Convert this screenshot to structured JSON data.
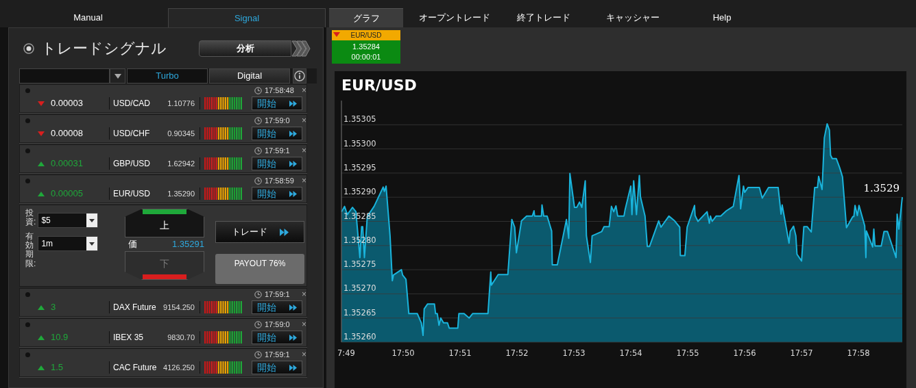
{
  "top_tabs_left": [
    {
      "label": "Manual",
      "selected": false
    },
    {
      "label": "Signal",
      "selected": true
    }
  ],
  "top_tabs_right": [
    {
      "label": "グラフ",
      "selected": true
    },
    {
      "label": "オープントレード",
      "selected": false
    },
    {
      "label": "終了トレード",
      "selected": false
    },
    {
      "label": "キャッシャー",
      "selected": false
    },
    {
      "label": "Help",
      "selected": false
    }
  ],
  "signal_panel": {
    "title": "トレードシグナル",
    "analysis_button": "分析",
    "filter_tabs": [
      {
        "label": "Turbo",
        "selected": true
      },
      {
        "label": "Digital",
        "selected": false
      }
    ],
    "items": [
      {
        "kind": "signal",
        "time": "17:58:48",
        "close": "×",
        "rising": false,
        "change": "0.00003",
        "asset": "USD/CAD",
        "price": "1.10776",
        "button": "開始"
      },
      {
        "kind": "signal",
        "time": "17:59:0",
        "close": "×",
        "rising": false,
        "change": "0.00008",
        "asset": "USD/CHF",
        "price": "0.90345",
        "button": "開始"
      },
      {
        "kind": "signal",
        "time": "17:59:1",
        "close": "×",
        "rising": true,
        "change": "0.00031",
        "asset": "GBP/USD",
        "price": "1.62942",
        "button": "開始"
      },
      {
        "kind": "signal",
        "time": "17:58:59",
        "close": "×",
        "rising": true,
        "change": "0.00005",
        "asset": "EUR/USD",
        "price": "1.35290",
        "button": "開始"
      },
      {
        "kind": "trade_form",
        "invest_label": "投資:",
        "invest_value": "$5",
        "expiry_label": "有効期限:",
        "expiry_value": "1m",
        "up_button": {
          "label": "上",
          "disabled": false
        },
        "price_label": "価",
        "price": "1.35291",
        "down_button": {
          "label": "下",
          "disabled": true
        },
        "trade_button": "トレード",
        "payout": "PAYOUT 76%"
      },
      {
        "kind": "signal",
        "time": "17:59:1",
        "close": "×",
        "rising": true,
        "change": "3",
        "asset": "DAX Future",
        "price": "9154.250",
        "button": "開始"
      },
      {
        "kind": "signal",
        "time": "17:59:0",
        "close": "×",
        "rising": true,
        "change": "10.9",
        "asset": "IBEX 35",
        "price": "9830.70",
        "button": "開始"
      },
      {
        "kind": "signal",
        "time": "17:59:1",
        "close": "×",
        "rising": true,
        "change": "1.5",
        "asset": "CAC Future",
        "price": "4126.250",
        "button": "開始"
      }
    ]
  },
  "ticker": {
    "rising": false,
    "asset": "EUR/USD",
    "price": "1.35284",
    "timer": "00:00:01"
  },
  "chart": {
    "cut_tick_label": "7:49",
    "chart_data": {
      "type": "area",
      "title": "EUR/USD",
      "grid": true,
      "xlim": [
        1068.916,
        1078.77
      ],
      "ylim": [
        1.3526,
        1.3531
      ],
      "xticks": [
        {
          "value": 1070,
          "label": "17:50"
        },
        {
          "value": 1071,
          "label": "17:51"
        },
        {
          "value": 1072,
          "label": "17:52"
        },
        {
          "value": 1073,
          "label": "17:53"
        },
        {
          "value": 1074,
          "label": "17:54"
        },
        {
          "value": 1075,
          "label": "17:55"
        },
        {
          "value": 1076,
          "label": "17:56"
        },
        {
          "value": 1077,
          "label": "17:57"
        },
        {
          "value": 1078,
          "label": "17:58"
        }
      ],
      "yticks": [
        {
          "value": 1.3526,
          "label": "1.35260"
        },
        {
          "value": 1.35265,
          "label": "1.35265"
        },
        {
          "value": 1.3527,
          "label": "1.35270"
        },
        {
          "value": 1.35275,
          "label": "1.35275"
        },
        {
          "value": 1.3528,
          "label": "1.35280"
        },
        {
          "value": 1.35285,
          "label": "1.35285"
        },
        {
          "value": 1.3529,
          "label": "1.35290"
        },
        {
          "value": 1.35295,
          "label": "1.35295"
        },
        {
          "value": 1.353,
          "label": "1.35300"
        },
        {
          "value": 1.35305,
          "label": "1.35305"
        }
      ],
      "x": [
        1068.92,
        1068.97,
        1069.02,
        1069.11,
        1069.17,
        1069.24,
        1069.27,
        1069.29,
        1069.32,
        1069.37,
        1069.49,
        1069.65,
        1069.67,
        1069.7,
        1069.77,
        1069.81,
        1069.83,
        1069.97,
        1069.99,
        1070.05,
        1070.1,
        1070.25,
        1070.32,
        1070.35,
        1070.37,
        1070.43,
        1070.55,
        1070.57,
        1070.6,
        1070.63,
        1070.66,
        1070.71,
        1070.78,
        1070.81,
        1070.96,
        1070.98,
        1071.07,
        1071.16,
        1071.22,
        1071.49,
        1071.54,
        1071.55,
        1071.67,
        1071.84,
        1071.91,
        1071.96,
        1071.99,
        1072.08,
        1072.17,
        1072.27,
        1072.3,
        1072.31,
        1072.43,
        1072.44,
        1072.47,
        1072.53,
        1072.61,
        1072.62,
        1072.71,
        1072.87,
        1072.91,
        1072.93,
        1073.01,
        1073.05,
        1073.1,
        1073.14,
        1073.2,
        1073.22,
        1073.29,
        1073.32,
        1073.49,
        1073.53,
        1073.62,
        1073.66,
        1073.7,
        1073.74,
        1073.77,
        1073.88,
        1073.9,
        1074.0,
        1074.02,
        1074.05,
        1074.1,
        1074.15,
        1074.17,
        1074.25,
        1074.29,
        1074.33,
        1074.49,
        1074.53,
        1074.67,
        1074.77,
        1074.86,
        1074.87,
        1074.95,
        1074.99,
        1075.12,
        1075.13,
        1075.18,
        1075.34,
        1075.38,
        1075.4,
        1075.43,
        1075.5,
        1075.58,
        1075.68,
        1075.8,
        1075.9,
        1075.93,
        1075.98,
        1076.0,
        1076.06,
        1076.26,
        1076.31,
        1076.42,
        1076.59,
        1076.64,
        1076.66,
        1076.78,
        1076.8,
        1076.86,
        1076.9,
        1076.92,
        1077.0,
        1077.04,
        1077.1,
        1077.17,
        1077.23,
        1077.28,
        1077.3,
        1077.36,
        1077.4,
        1077.45,
        1077.49,
        1077.51,
        1077.54,
        1077.61,
        1077.67,
        1077.72,
        1077.79,
        1077.9,
        1077.92,
        1077.94,
        1077.98,
        1078.01,
        1078.11,
        1078.13,
        1078.14,
        1078.25,
        1078.27,
        1078.29,
        1078.4,
        1078.45,
        1078.51,
        1078.66,
        1078.68,
        1078.71,
        1078.77
      ],
      "series": [
        {
          "color": "#1ab4dc",
          "values": [
            1.35287,
            1.352881,
            1.352864,
            1.352879,
            1.35287,
            1.352775,
            1.352839,
            1.352839,
            1.352775,
            1.35286,
            1.352881,
            1.352921,
            1.352912,
            1.352923,
            1.35282,
            1.352727,
            1.352739,
            1.35275,
            1.352739,
            1.35273,
            1.352659,
            1.352659,
            1.35264,
            1.352614,
            1.352669,
            1.352679,
            1.352679,
            1.352659,
            1.352659,
            1.352635,
            1.35265,
            1.35264,
            1.35264,
            1.352629,
            1.352629,
            1.352659,
            1.352659,
            1.35265,
            1.352659,
            1.352659,
            1.352745,
            1.352718,
            1.35274,
            1.35274,
            1.352854,
            1.352838,
            1.352785,
            1.352851,
            1.352861,
            1.352861,
            1.352872,
            1.352861,
            1.352861,
            1.352884,
            1.352861,
            1.352861,
            1.35283,
            1.35276,
            1.35276,
            1.352854,
            1.352815,
            1.352949,
            1.352879,
            1.352879,
            1.35289,
            1.352879,
            1.352934,
            1.35282,
            1.352765,
            1.35282,
            1.352829,
            1.352839,
            1.352839,
            1.352881,
            1.35287,
            1.352882,
            1.352861,
            1.352861,
            1.352874,
            1.352923,
            1.352864,
            1.352934,
            1.352864,
            1.352945,
            1.352901,
            1.352861,
            1.352798,
            1.352798,
            1.352851,
            1.352838,
            1.352861,
            1.352851,
            1.352838,
            1.352779,
            1.352779,
            1.352838,
            1.352883,
            1.352862,
            1.35285,
            1.35287,
            1.352846,
            1.352861,
            1.35285,
            1.352861,
            1.352861,
            1.352872,
            1.352881,
            1.352945,
            1.352876,
            1.352923,
            1.35291,
            1.35292,
            1.35292,
            1.352898,
            1.35292,
            1.35292,
            1.352865,
            1.352884,
            1.352805,
            1.352829,
            1.35284,
            1.35282,
            1.352782,
            1.352768,
            1.352839,
            1.352839,
            1.352828,
            1.35292,
            1.35292,
            1.352943,
            1.352916,
            1.353023,
            1.353052,
            1.353039,
            1.352987,
            1.35298,
            1.35298,
            1.352961,
            1.352942,
            1.352837,
            1.35286,
            1.35286,
            1.352883,
            1.352862,
            1.352883,
            1.352841,
            1.352775,
            1.35283,
            1.352797,
            1.352834,
            1.352799,
            1.352799,
            1.352829,
            1.352829,
            1.352775,
            1.352865,
            1.352834,
            1.3529
          ]
        }
      ],
      "annotations": [
        "1.3529"
      ]
    }
  }
}
